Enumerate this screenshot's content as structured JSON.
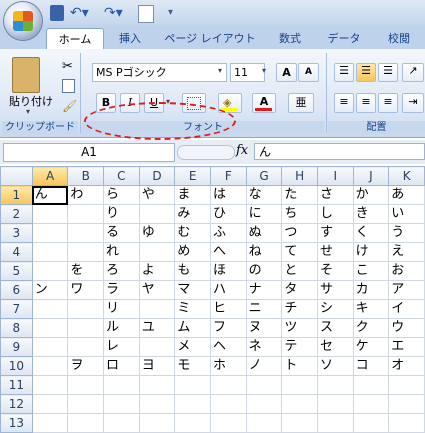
{
  "tabs": [
    "ホーム",
    "挿入",
    "ページ レイアウト",
    "数式",
    "データ",
    "校閲"
  ],
  "ribbon": {
    "paste_label": "貼り付け",
    "clipboard_label": "クリップボード",
    "font_name": "MS Pゴシック",
    "font_size": "11",
    "font_group_label": "フォント",
    "align_group_label": "配置",
    "grow_font": "A",
    "shrink_font": "A",
    "bold": "B",
    "italic": "I",
    "underline": "U",
    "font_color": "A",
    "phonetic": "亜"
  },
  "formula_bar": {
    "name_box": "A1",
    "fx": "fx",
    "value": "ん"
  },
  "columns": [
    "A",
    "B",
    "C",
    "D",
    "E",
    "F",
    "G",
    "H",
    "I",
    "J",
    "K"
  ],
  "rows": [
    [
      "ん",
      "わ",
      "ら",
      "や",
      "ま",
      "は",
      "な",
      "た",
      "さ",
      "か",
      "あ"
    ],
    [
      "",
      "",
      "り",
      "",
      "み",
      "ひ",
      "に",
      "ち",
      "し",
      "き",
      "い"
    ],
    [
      "",
      "",
      "る",
      "ゆ",
      "む",
      "ふ",
      "ぬ",
      "つ",
      "す",
      "く",
      "う"
    ],
    [
      "",
      "",
      "れ",
      "",
      "め",
      "へ",
      "ね",
      "て",
      "せ",
      "け",
      "え"
    ],
    [
      "",
      "を",
      "ろ",
      "よ",
      "も",
      "ほ",
      "の",
      "と",
      "そ",
      "こ",
      "お"
    ],
    [
      "ン",
      "ワ",
      "ラ",
      "ヤ",
      "マ",
      "ハ",
      "ナ",
      "タ",
      "サ",
      "カ",
      "ア"
    ],
    [
      "",
      "",
      "リ",
      "",
      "ミ",
      "ヒ",
      "ニ",
      "チ",
      "シ",
      "キ",
      "イ"
    ],
    [
      "",
      "",
      "ル",
      "ユ",
      "ム",
      "フ",
      "ヌ",
      "ツ",
      "ス",
      "ク",
      "ウ"
    ],
    [
      "",
      "",
      "レ",
      "",
      "メ",
      "ヘ",
      "ネ",
      "テ",
      "セ",
      "ケ",
      "エ"
    ],
    [
      "",
      "ヲ",
      "ロ",
      "ヨ",
      "モ",
      "ホ",
      "ノ",
      "ト",
      "ソ",
      "コ",
      "オ"
    ],
    [
      "",
      "",
      "",
      "",
      "",
      "",
      "",
      "",
      "",
      "",
      ""
    ],
    [
      "",
      "",
      "",
      "",
      "",
      "",
      "",
      "",
      "",
      "",
      ""
    ],
    [
      "",
      "",
      "",
      "",
      "",
      "",
      "",
      "",
      "",
      "",
      ""
    ]
  ],
  "row_numbers": [
    "1",
    "2",
    "3",
    "4",
    "5",
    "6",
    "7",
    "8",
    "9",
    "10",
    "11",
    "12",
    "13"
  ]
}
